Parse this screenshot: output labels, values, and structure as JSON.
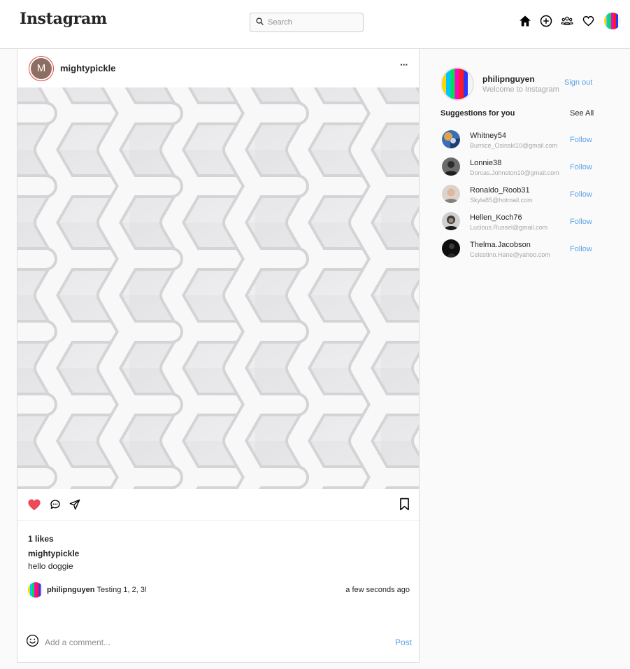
{
  "header": {
    "logo": "Instagram",
    "search_placeholder": "Search",
    "icons": [
      "home-icon",
      "add-post-icon",
      "people-icon",
      "heart-icon"
    ]
  },
  "post": {
    "avatar_letter": "M",
    "username": "mightypickle",
    "more_label": "···",
    "image_description": "white abstract woven pattern",
    "likes": "1 likes",
    "caption_user": "mightypickle",
    "caption_text": "hello doggie",
    "comments": [
      {
        "user": "philipnguyen",
        "text": "Testing 1, 2, 3!",
        "time": "a few seconds ago"
      }
    ],
    "add_comment_placeholder": "Add a comment...",
    "post_label": "Post",
    "liked_color": "#ed4956"
  },
  "sidebar": {
    "profile": {
      "username": "philipnguyen",
      "subtitle": "Welcome to Instagram",
      "sign_out": "Sign out"
    },
    "suggestions_title": "Suggestions for you",
    "see_all": "See All",
    "follow_label": "Follow",
    "suggestions": [
      {
        "name": "Whitney54",
        "email": "Burnice_Osinski10@gmail.com"
      },
      {
        "name": "Lonnie38",
        "email": "Dorcas.Johnston10@gmail.com"
      },
      {
        "name": "Ronaldo_Roob31",
        "email": "Skyla85@hotmail.com"
      },
      {
        "name": "Hellen_Koch76",
        "email": "Lucious.Russel@gmail.com"
      },
      {
        "name": "Thelma.Jacobson",
        "email": "Celestino.Hane@yahoo.com"
      }
    ]
  },
  "colors": {
    "accent": "#5aa3e8",
    "border": "#dbdbdb",
    "like": "#ed4956"
  }
}
